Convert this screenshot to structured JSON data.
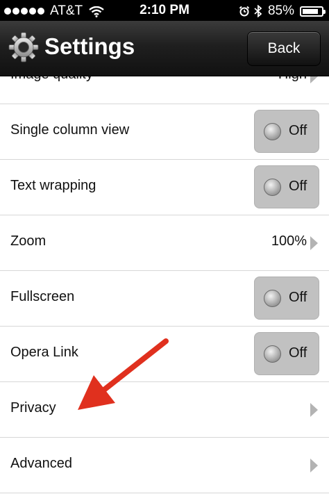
{
  "status_bar": {
    "carrier": "AT&T",
    "time": "2:10 PM",
    "battery": "85%",
    "battery_level": 0.85,
    "icons": [
      "signal-dots",
      "wifi-icon",
      "alarm-icon",
      "bluetooth-icon",
      "battery-icon"
    ]
  },
  "header": {
    "title": "Settings",
    "back_label": "Back",
    "icon": "gear-icon"
  },
  "rows": {
    "image_quality": {
      "label": "Image quality",
      "value": "High"
    },
    "single_column": {
      "label": "Single column view",
      "state": "Off"
    },
    "text_wrapping": {
      "label": "Text wrapping",
      "state": "Off"
    },
    "zoom": {
      "label": "Zoom",
      "value": "100%"
    },
    "fullscreen": {
      "label": "Fullscreen",
      "state": "Off"
    },
    "opera_link": {
      "label": "Opera Link",
      "state": "Off"
    },
    "privacy": {
      "label": "Privacy"
    },
    "advanced": {
      "label": "Advanced"
    }
  },
  "colors": {
    "header_bg": "#1f1f1f",
    "toggle_bg": "#c1c1c1",
    "divider": "#d7d7d7",
    "arrow_red": "#e0301e"
  }
}
